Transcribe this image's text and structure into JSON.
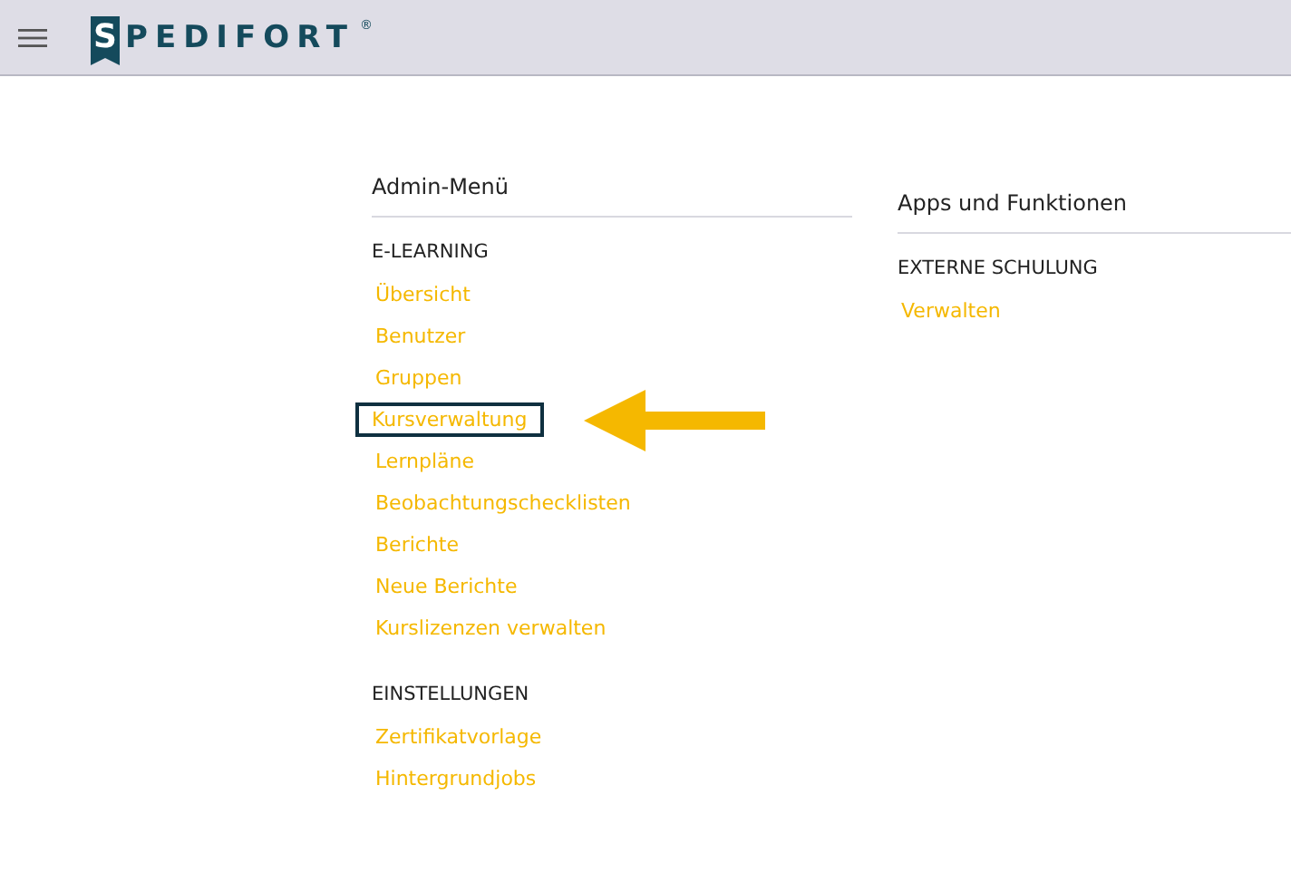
{
  "header": {
    "logo": {
      "badge_letter": "S",
      "text": "PEDIFORT",
      "mark": "®"
    }
  },
  "admin_menu": {
    "title": "Admin-Menü",
    "sections": [
      {
        "heading": "E-LEARNING",
        "links": [
          {
            "label": "Übersicht",
            "highlighted": false
          },
          {
            "label": "Benutzer",
            "highlighted": false
          },
          {
            "label": "Gruppen",
            "highlighted": false
          },
          {
            "label": "Kursverwaltung",
            "highlighted": true
          },
          {
            "label": "Lernpläne",
            "highlighted": false
          },
          {
            "label": "Beobachtungschecklisten",
            "highlighted": false
          },
          {
            "label": "Berichte",
            "highlighted": false
          },
          {
            "label": "Neue Berichte",
            "highlighted": false
          },
          {
            "label": "Kurslizenzen verwalten",
            "highlighted": false
          }
        ]
      },
      {
        "heading": "EINSTELLUNGEN",
        "links": [
          {
            "label": "Zertifikatvorlage",
            "highlighted": false
          },
          {
            "label": "Hintergrundjobs",
            "highlighted": false
          }
        ]
      }
    ]
  },
  "apps": {
    "title": "Apps und Funktionen",
    "sections": [
      {
        "heading": "EXTERNE SCHULUNG",
        "links": [
          {
            "label": "Verwalten",
            "highlighted": false
          }
        ]
      }
    ]
  }
}
